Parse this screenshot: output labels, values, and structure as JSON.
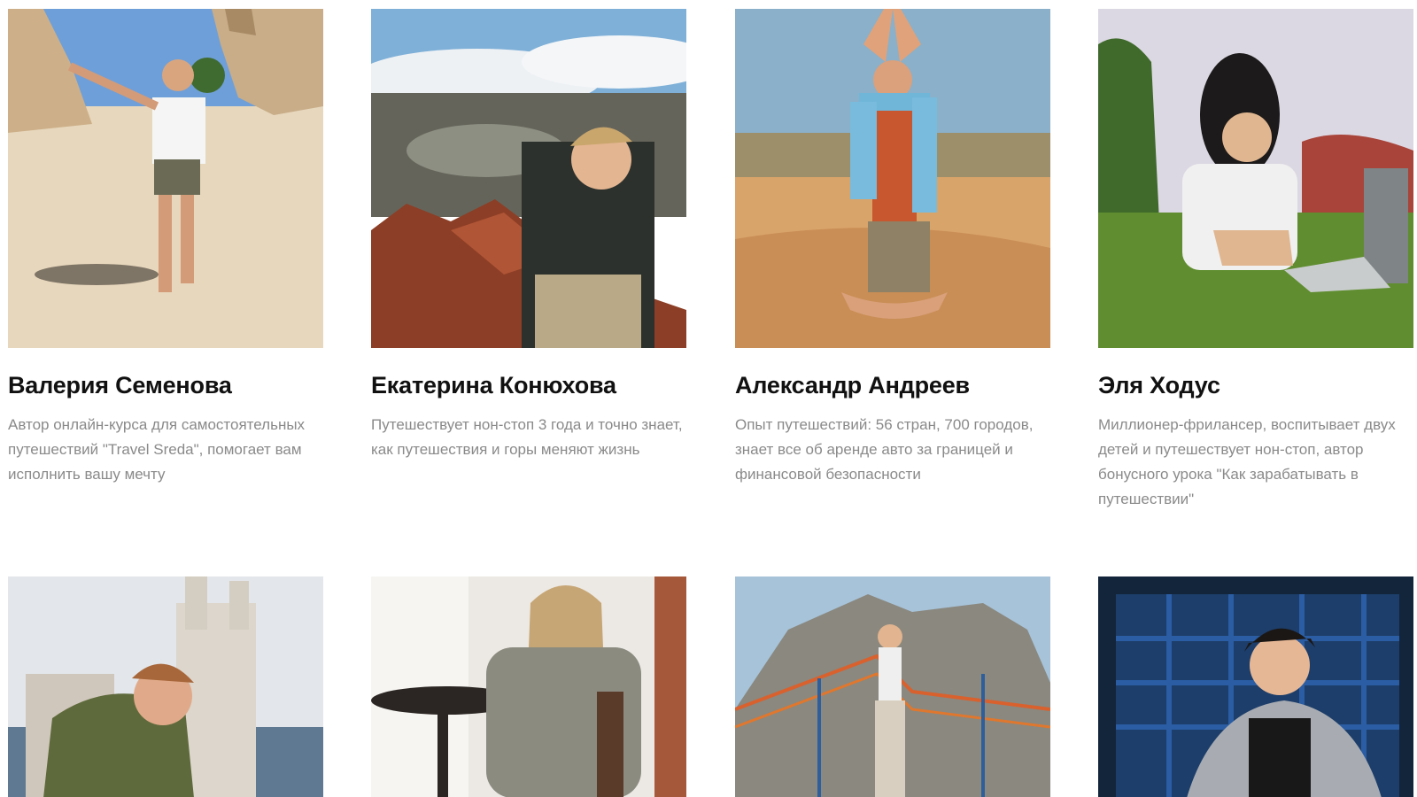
{
  "authors": [
    {
      "name": "Валерия Семенова",
      "description": "Автор онлайн-курса для самостоятельных путешествий \"Travel Sreda\", помогает вам исполнить вашу мечту"
    },
    {
      "name": "Екатерина Конюхова",
      "description": "Путешествует нон-стоп 3 года и точно знает, как путешествия и горы меняют жизнь"
    },
    {
      "name": "Александр Андреев",
      "description": "Опыт путешествий: 56 стран, 700 городов, знает все об аренде авто за границей и финансовой безопасности"
    },
    {
      "name": "Эля Ходус",
      "description": "Миллионер-фрилансер, воспитывает двух детей и путешествует нон-стоп, автор бонусного урока \"Как зарабатывать в путешествии\""
    }
  ],
  "colors": {
    "name": "#111111",
    "description": "#8a8a8a",
    "background": "#ffffff"
  }
}
